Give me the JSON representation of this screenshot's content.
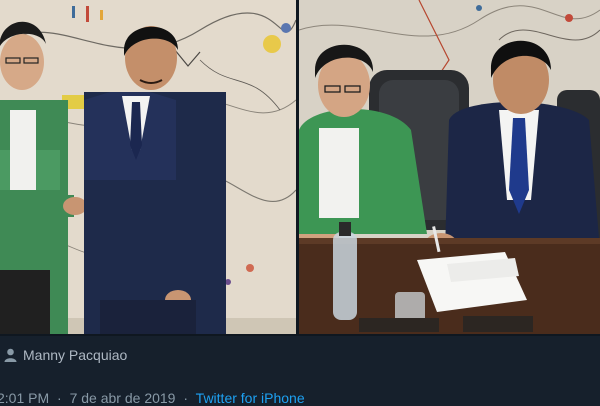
{
  "tweet": {
    "media_tag": {
      "icon": "person-icon",
      "name": "Manny Pacquiao"
    },
    "meta": {
      "time": "2:01 PM",
      "separator": "·",
      "date": "7 de abr de 2019",
      "source": "Twitter for iPhone"
    }
  },
  "colors": {
    "background": "#16202c",
    "meta_text": "#8899a6",
    "link": "#1da1f2"
  }
}
